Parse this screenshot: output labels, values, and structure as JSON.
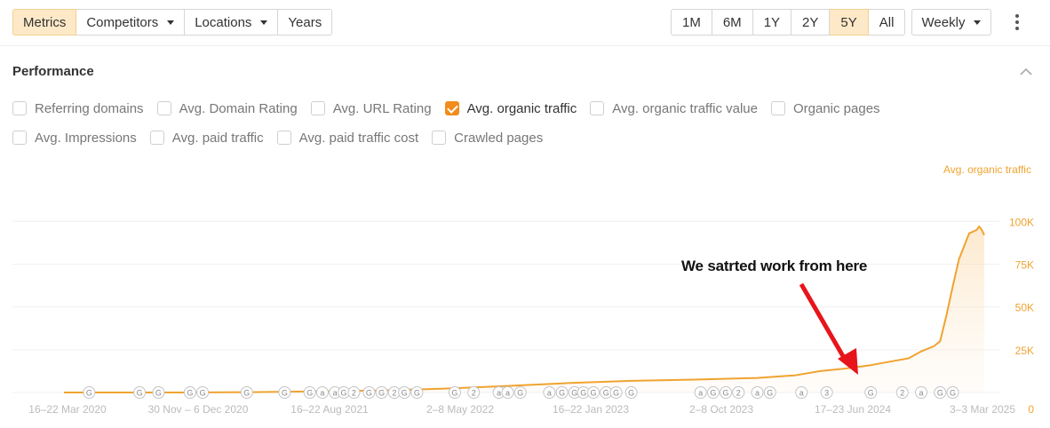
{
  "toolbar": {
    "left_tabs": [
      {
        "label": "Metrics",
        "active": true,
        "dropdown": false
      },
      {
        "label": "Competitors",
        "active": false,
        "dropdown": true
      },
      {
        "label": "Locations",
        "active": false,
        "dropdown": true
      },
      {
        "label": "Years",
        "active": false,
        "dropdown": false
      }
    ],
    "ranges": [
      {
        "label": "1M",
        "active": false
      },
      {
        "label": "6M",
        "active": false
      },
      {
        "label": "1Y",
        "active": false
      },
      {
        "label": "2Y",
        "active": false
      },
      {
        "label": "5Y",
        "active": true
      },
      {
        "label": "All",
        "active": false
      }
    ],
    "interval": "Weekly"
  },
  "performance": {
    "title": "Performance",
    "metrics_row1": [
      {
        "label": "Referring domains",
        "checked": false
      },
      {
        "label": "Avg. Domain Rating",
        "checked": false
      },
      {
        "label": "Avg. URL Rating",
        "checked": false
      },
      {
        "label": "Avg. organic traffic",
        "checked": true
      },
      {
        "label": "Avg. organic traffic value",
        "checked": false
      },
      {
        "label": "Organic pages",
        "checked": false
      }
    ],
    "metrics_row2": [
      {
        "label": "Avg. Impressions",
        "checked": false
      },
      {
        "label": "Avg. paid traffic",
        "checked": false
      },
      {
        "label": "Avg. paid traffic cost",
        "checked": false
      },
      {
        "label": "Crawled pages",
        "checked": false
      }
    ]
  },
  "annotation": "We satrted work from here",
  "colors": {
    "accent": "#f28c1b",
    "line": "#f0a330",
    "active_bg": "#fde9c7",
    "arrow": "#e8141b"
  },
  "chart_data": {
    "type": "area",
    "series_label": "Avg. organic traffic",
    "x_tick_labels": [
      "16–22 Mar 2020",
      "30 Nov – 6 Dec 2020",
      "16–22 Aug 2021",
      "2–8 May 2022",
      "16–22 Jan 2023",
      "2–8 Oct 2023",
      "17–23 Jun 2024",
      "3–3 Mar 2025"
    ],
    "y_tick_labels": [
      "0",
      "25K",
      "50K",
      "75K",
      "100K"
    ],
    "ylim": [
      0,
      110000
    ],
    "x": [
      0,
      0.5,
      1.0,
      1.5,
      2.0,
      2.5,
      3.0,
      3.5,
      4.0,
      4.5,
      5.0,
      5.5,
      5.8,
      6.0,
      6.2,
      6.4,
      6.55,
      6.7,
      6.8,
      6.9,
      6.95,
      7.0,
      7.05,
      7.1,
      7.18,
      7.24,
      7.26,
      7.28,
      7.3
    ],
    "values": [
      0,
      0,
      0,
      200,
      700,
      1200,
      2200,
      3800,
      5500,
      6800,
      7500,
      8500,
      10000,
      12500,
      14000,
      16000,
      18000,
      20000,
      24000,
      27000,
      30000,
      45000,
      62000,
      78000,
      93000,
      95000,
      97000,
      95000,
      92000
    ],
    "markers": {
      "row": [
        "G",
        "G",
        "G",
        "G",
        "G",
        "G",
        "G",
        "G",
        "a",
        "a",
        "G",
        "2",
        "G",
        "G",
        "2",
        "G",
        "G",
        "G",
        "2",
        "a",
        "a",
        "G",
        "a",
        "G",
        "G",
        "G",
        "G",
        "G",
        "G",
        "G",
        "a",
        "G",
        "G",
        "2",
        "a",
        "G",
        "a",
        "3",
        "G",
        "2",
        "a",
        "G",
        "G"
      ],
      "x_positions": [
        0.2,
        0.6,
        0.75,
        1.0,
        1.1,
        1.45,
        1.75,
        1.95,
        2.05,
        2.15,
        2.22,
        2.3,
        2.42,
        2.52,
        2.62,
        2.7,
        2.8,
        3.1,
        3.25,
        3.45,
        3.52,
        3.62,
        3.85,
        3.95,
        4.05,
        4.12,
        4.2,
        4.3,
        4.38,
        4.5,
        5.05,
        5.15,
        5.25,
        5.35,
        5.5,
        5.6,
        5.85,
        6.05,
        6.4,
        6.65,
        6.8,
        6.95,
        7.05
      ]
    },
    "grid": true
  }
}
